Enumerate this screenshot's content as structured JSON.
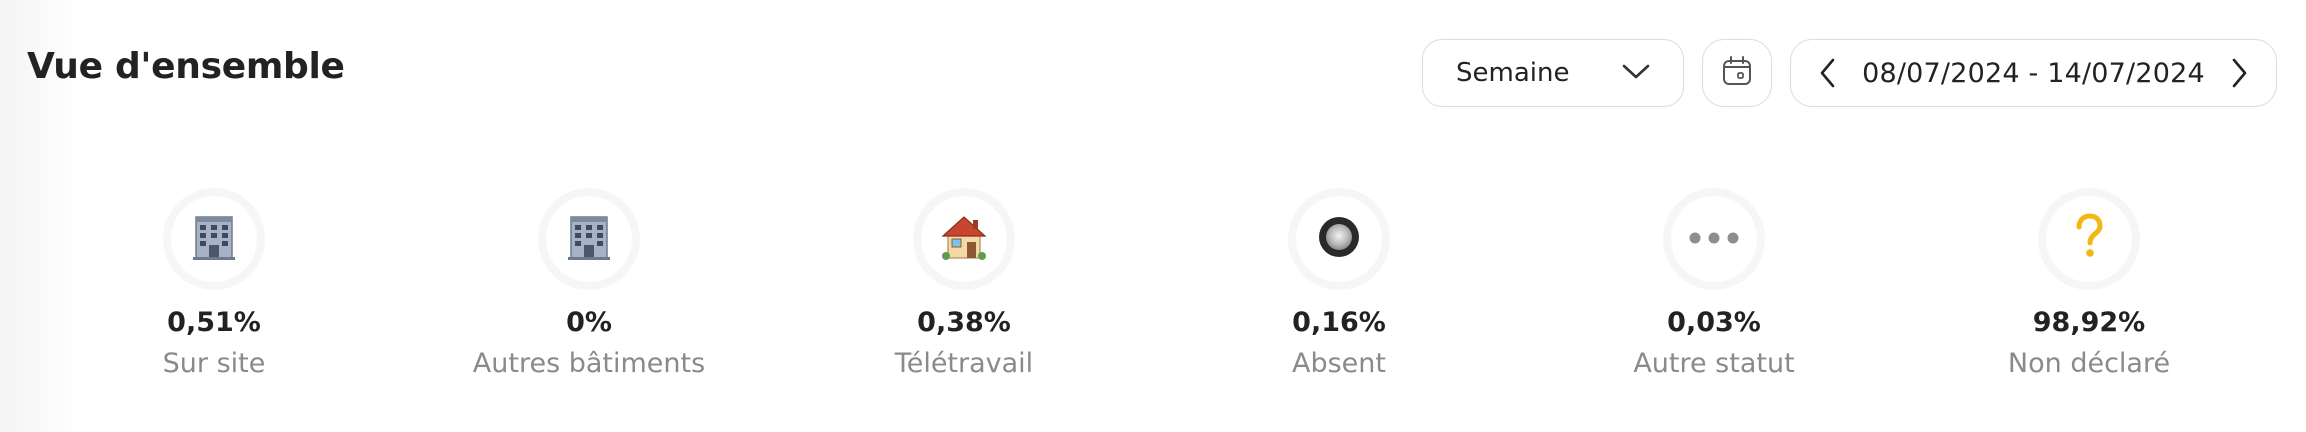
{
  "header": {
    "title": "Vue d'ensemble",
    "period_select": {
      "selected": "Semaine"
    },
    "date_range": "08/07/2024 - 14/07/2024"
  },
  "stats": [
    {
      "icon": "office-building-icon",
      "value": "0,51%",
      "label": "Sur site"
    },
    {
      "icon": "office-building-icon",
      "value": "0%",
      "label": "Autres bâtiments"
    },
    {
      "icon": "house-icon",
      "value": "0,38%",
      "label": "Télétravail"
    },
    {
      "icon": "absent-circle-icon",
      "value": "0,16%",
      "label": "Absent"
    },
    {
      "icon": "more-dots-icon",
      "value": "0,03%",
      "label": "Autre statut"
    },
    {
      "icon": "question-mark-icon",
      "value": "98,92%",
      "label": "Non déclaré"
    }
  ],
  "colors": {
    "question_mark": "#f2b713",
    "border": "#dcdcdc",
    "label_gray": "#8a8a8a"
  }
}
